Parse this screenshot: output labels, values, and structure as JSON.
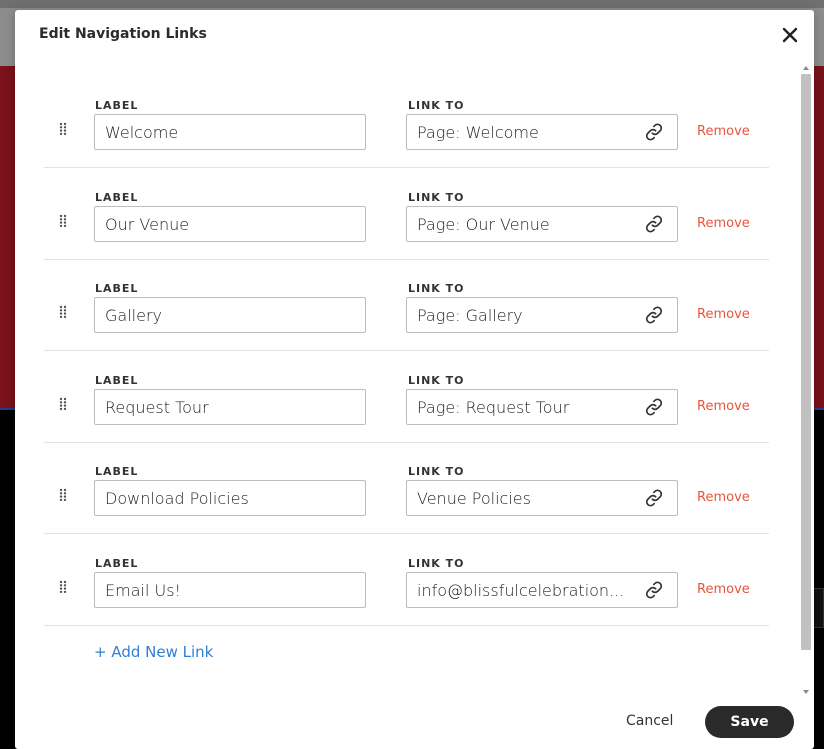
{
  "modal": {
    "title": "Edit Navigation Links",
    "close_icon": "close-icon",
    "label_caption": "LABEL",
    "link_caption": "LINK TO",
    "remove_label": "Remove",
    "add_link_label": "+ Add New Link",
    "cancel_label": "Cancel",
    "save_label": "Save",
    "links": [
      {
        "label": "Welcome",
        "link_to": "Page: Welcome"
      },
      {
        "label": "Our Venue",
        "link_to": "Page: Our Venue"
      },
      {
        "label": "Gallery",
        "link_to": "Page: Gallery"
      },
      {
        "label": "Request Tour",
        "link_to": "Page: Request Tour"
      },
      {
        "label": "Download Policies",
        "link_to": "Venue Policies"
      },
      {
        "label": "Email Us!",
        "link_to": "info@blissfulcelebration..."
      }
    ]
  },
  "colors": {
    "remove": "#e8553e",
    "add_link": "#2f80d1",
    "save_bg": "#2a2a2a"
  }
}
